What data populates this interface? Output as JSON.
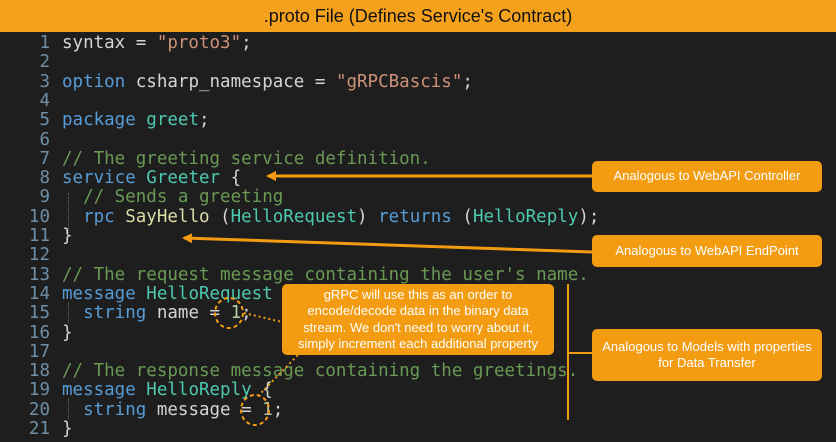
{
  "title": ".proto File (Defines Service's Contract)",
  "code_lines": [
    [
      {
        "t": "syntax = ",
        "c": "pl"
      },
      {
        "t": "\"proto3\"",
        "c": "st"
      },
      {
        "t": ";",
        "c": "pl"
      }
    ],
    [],
    [
      {
        "t": "option ",
        "c": "kw"
      },
      {
        "t": "csharp_namespace = ",
        "c": "pl"
      },
      {
        "t": "\"gRPCBascis\"",
        "c": "st"
      },
      {
        "t": ";",
        "c": "pl"
      }
    ],
    [],
    [
      {
        "t": "package ",
        "c": "kw"
      },
      {
        "t": "greet",
        "c": "ty"
      },
      {
        "t": ";",
        "c": "pl"
      }
    ],
    [],
    [
      {
        "t": "// The greeting service definition.",
        "c": "cm"
      }
    ],
    [
      {
        "t": "service ",
        "c": "kw"
      },
      {
        "t": "Greeter",
        "c": "ty"
      },
      {
        "t": " {",
        "c": "pl"
      }
    ],
    [
      {
        "t": "  ",
        "c": "pl"
      },
      {
        "t": "// Sends a greeting",
        "c": "cm"
      }
    ],
    [
      {
        "t": "  ",
        "c": "pl"
      },
      {
        "t": "rpc ",
        "c": "kw"
      },
      {
        "t": "SayHello",
        "c": "fn"
      },
      {
        "t": " (",
        "c": "pl"
      },
      {
        "t": "HelloRequest",
        "c": "ty"
      },
      {
        "t": ") ",
        "c": "pl"
      },
      {
        "t": "returns",
        "c": "kw"
      },
      {
        "t": " (",
        "c": "pl"
      },
      {
        "t": "HelloReply",
        "c": "ty"
      },
      {
        "t": ");",
        "c": "pl"
      }
    ],
    [
      {
        "t": "}",
        "c": "pl"
      }
    ],
    [],
    [
      {
        "t": "// The request message containing the user's name.",
        "c": "cm"
      }
    ],
    [
      {
        "t": "message ",
        "c": "kw"
      },
      {
        "t": "HelloRequest",
        "c": "ty"
      },
      {
        "t": " {",
        "c": "pl"
      }
    ],
    [
      {
        "t": "  ",
        "c": "pl"
      },
      {
        "t": "string ",
        "c": "kw"
      },
      {
        "t": "name = ",
        "c": "pl"
      },
      {
        "t": "1",
        "c": "nu"
      },
      {
        "t": ";",
        "c": "pl"
      }
    ],
    [
      {
        "t": "}",
        "c": "pl"
      }
    ],
    [],
    [
      {
        "t": "// The response message containing the greetings.",
        "c": "cm"
      }
    ],
    [
      {
        "t": "message ",
        "c": "kw"
      },
      {
        "t": "HelloReply",
        "c": "ty"
      },
      {
        "t": " {",
        "c": "pl"
      }
    ],
    [
      {
        "t": "  ",
        "c": "pl"
      },
      {
        "t": "string ",
        "c": "kw"
      },
      {
        "t": "message = ",
        "c": "pl"
      },
      {
        "t": "1",
        "c": "nu"
      },
      {
        "t": ";",
        "c": "pl"
      }
    ],
    [
      {
        "t": "}",
        "c": "pl"
      }
    ]
  ],
  "callouts": {
    "controller": "Analogous to WebAPI Controller",
    "endpoint": "Analogous to WebAPI EndPoint",
    "order": "gRPC will use this as an order to encode/decode data in the binary data stream. We don't need to worry about it, simply increment each additional property",
    "models": "Analogous to Models with properties for Data Transfer"
  },
  "colors": {
    "header_bg": "#f6a11b",
    "callout_bg": "#f39c12",
    "editor_bg": "#1e1e1e"
  }
}
